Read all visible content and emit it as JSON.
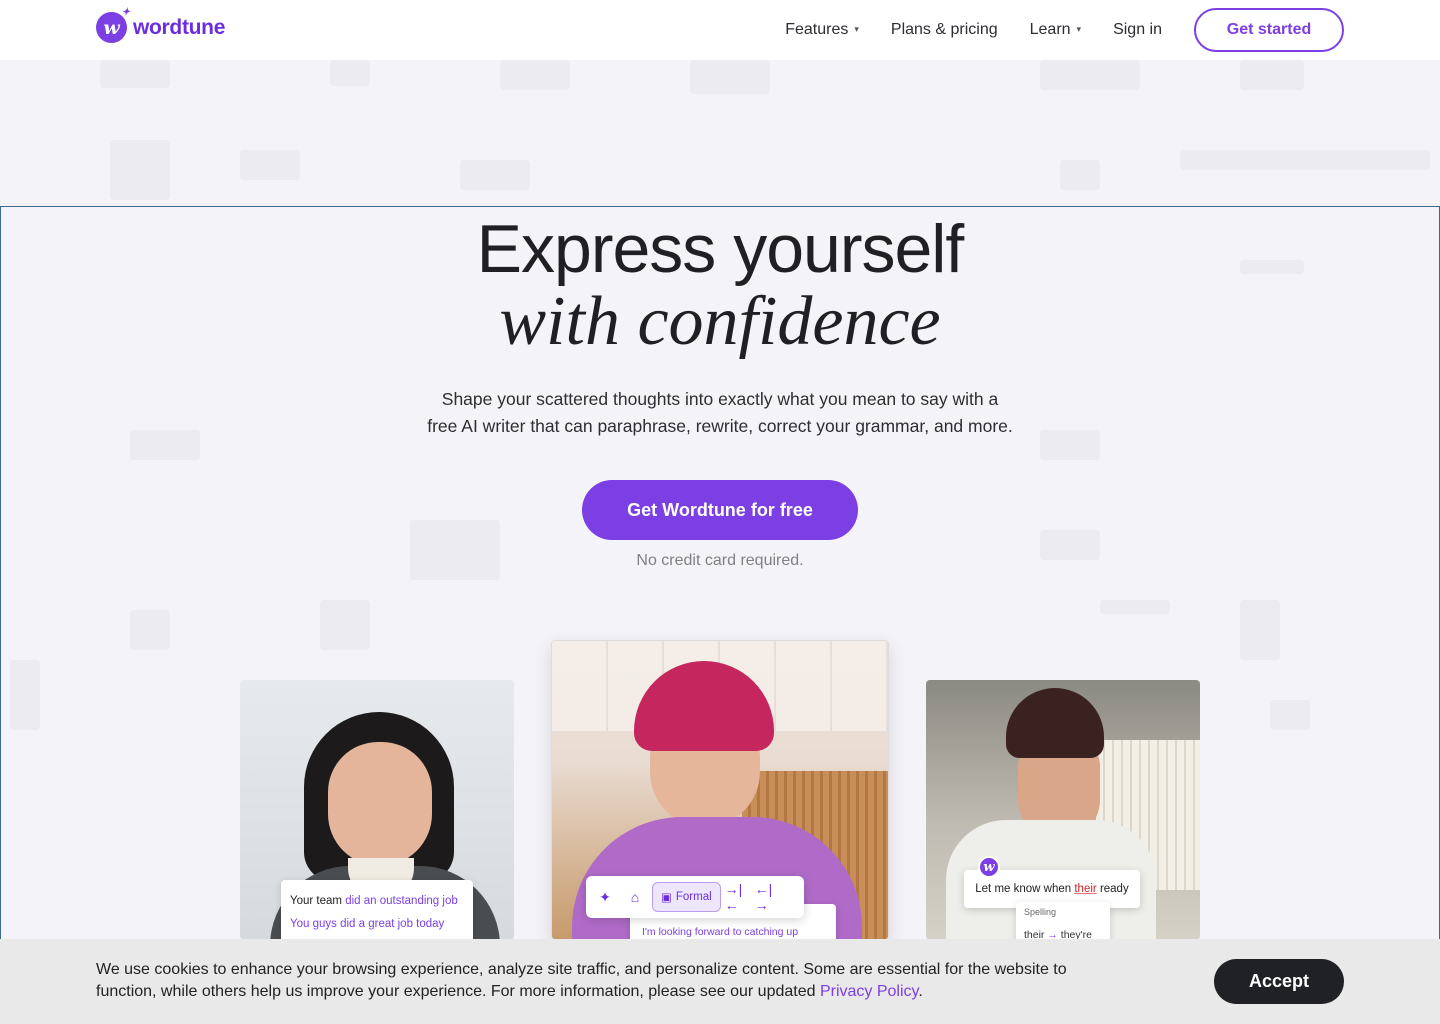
{
  "brand": {
    "name": "wordtune",
    "logo_letter": "w",
    "accent": "#7b3fe4"
  },
  "nav": {
    "items": [
      {
        "label": "Features",
        "has_dropdown": true
      },
      {
        "label": "Plans & pricing",
        "has_dropdown": false
      },
      {
        "label": "Learn",
        "has_dropdown": true
      },
      {
        "label": "Sign in",
        "has_dropdown": false
      }
    ],
    "cta": "Get started"
  },
  "hero": {
    "title_line1": "Express yourself",
    "title_line2": "with confidence",
    "subtitle_line1": "Shape your scattered thoughts into exactly what you mean to say with a",
    "subtitle_line2": "free AI writer that can paraphrase, rewrite, correct your grammar, and more.",
    "cta": "Get Wordtune for free",
    "note": "No credit card required."
  },
  "cards": {
    "card1": {
      "line1_prefix": "Your team ",
      "line1_highlight": "did an outstanding job",
      "line2": "You guys did a great job today"
    },
    "card2": {
      "tone_label": "Formal",
      "suggestion": "I'm looking forward to catching up"
    },
    "card3": {
      "text_prefix": "Let me know when ",
      "text_error": "their",
      "text_suffix": " ready",
      "spell_label": "Spelling",
      "spell_from": "their",
      "spell_arrow": "→",
      "spell_to": "they're"
    }
  },
  "cookie": {
    "text_line1": "We use cookies to enhance your browsing experience, analyze site traffic, and personalize content. Some are essential for the website to",
    "text_line2_prefix": "function, while others help us improve your experience. For more information, please see our updated ",
    "link": "Privacy Policy",
    "text_line2_suffix": ".",
    "accept": "Accept"
  }
}
